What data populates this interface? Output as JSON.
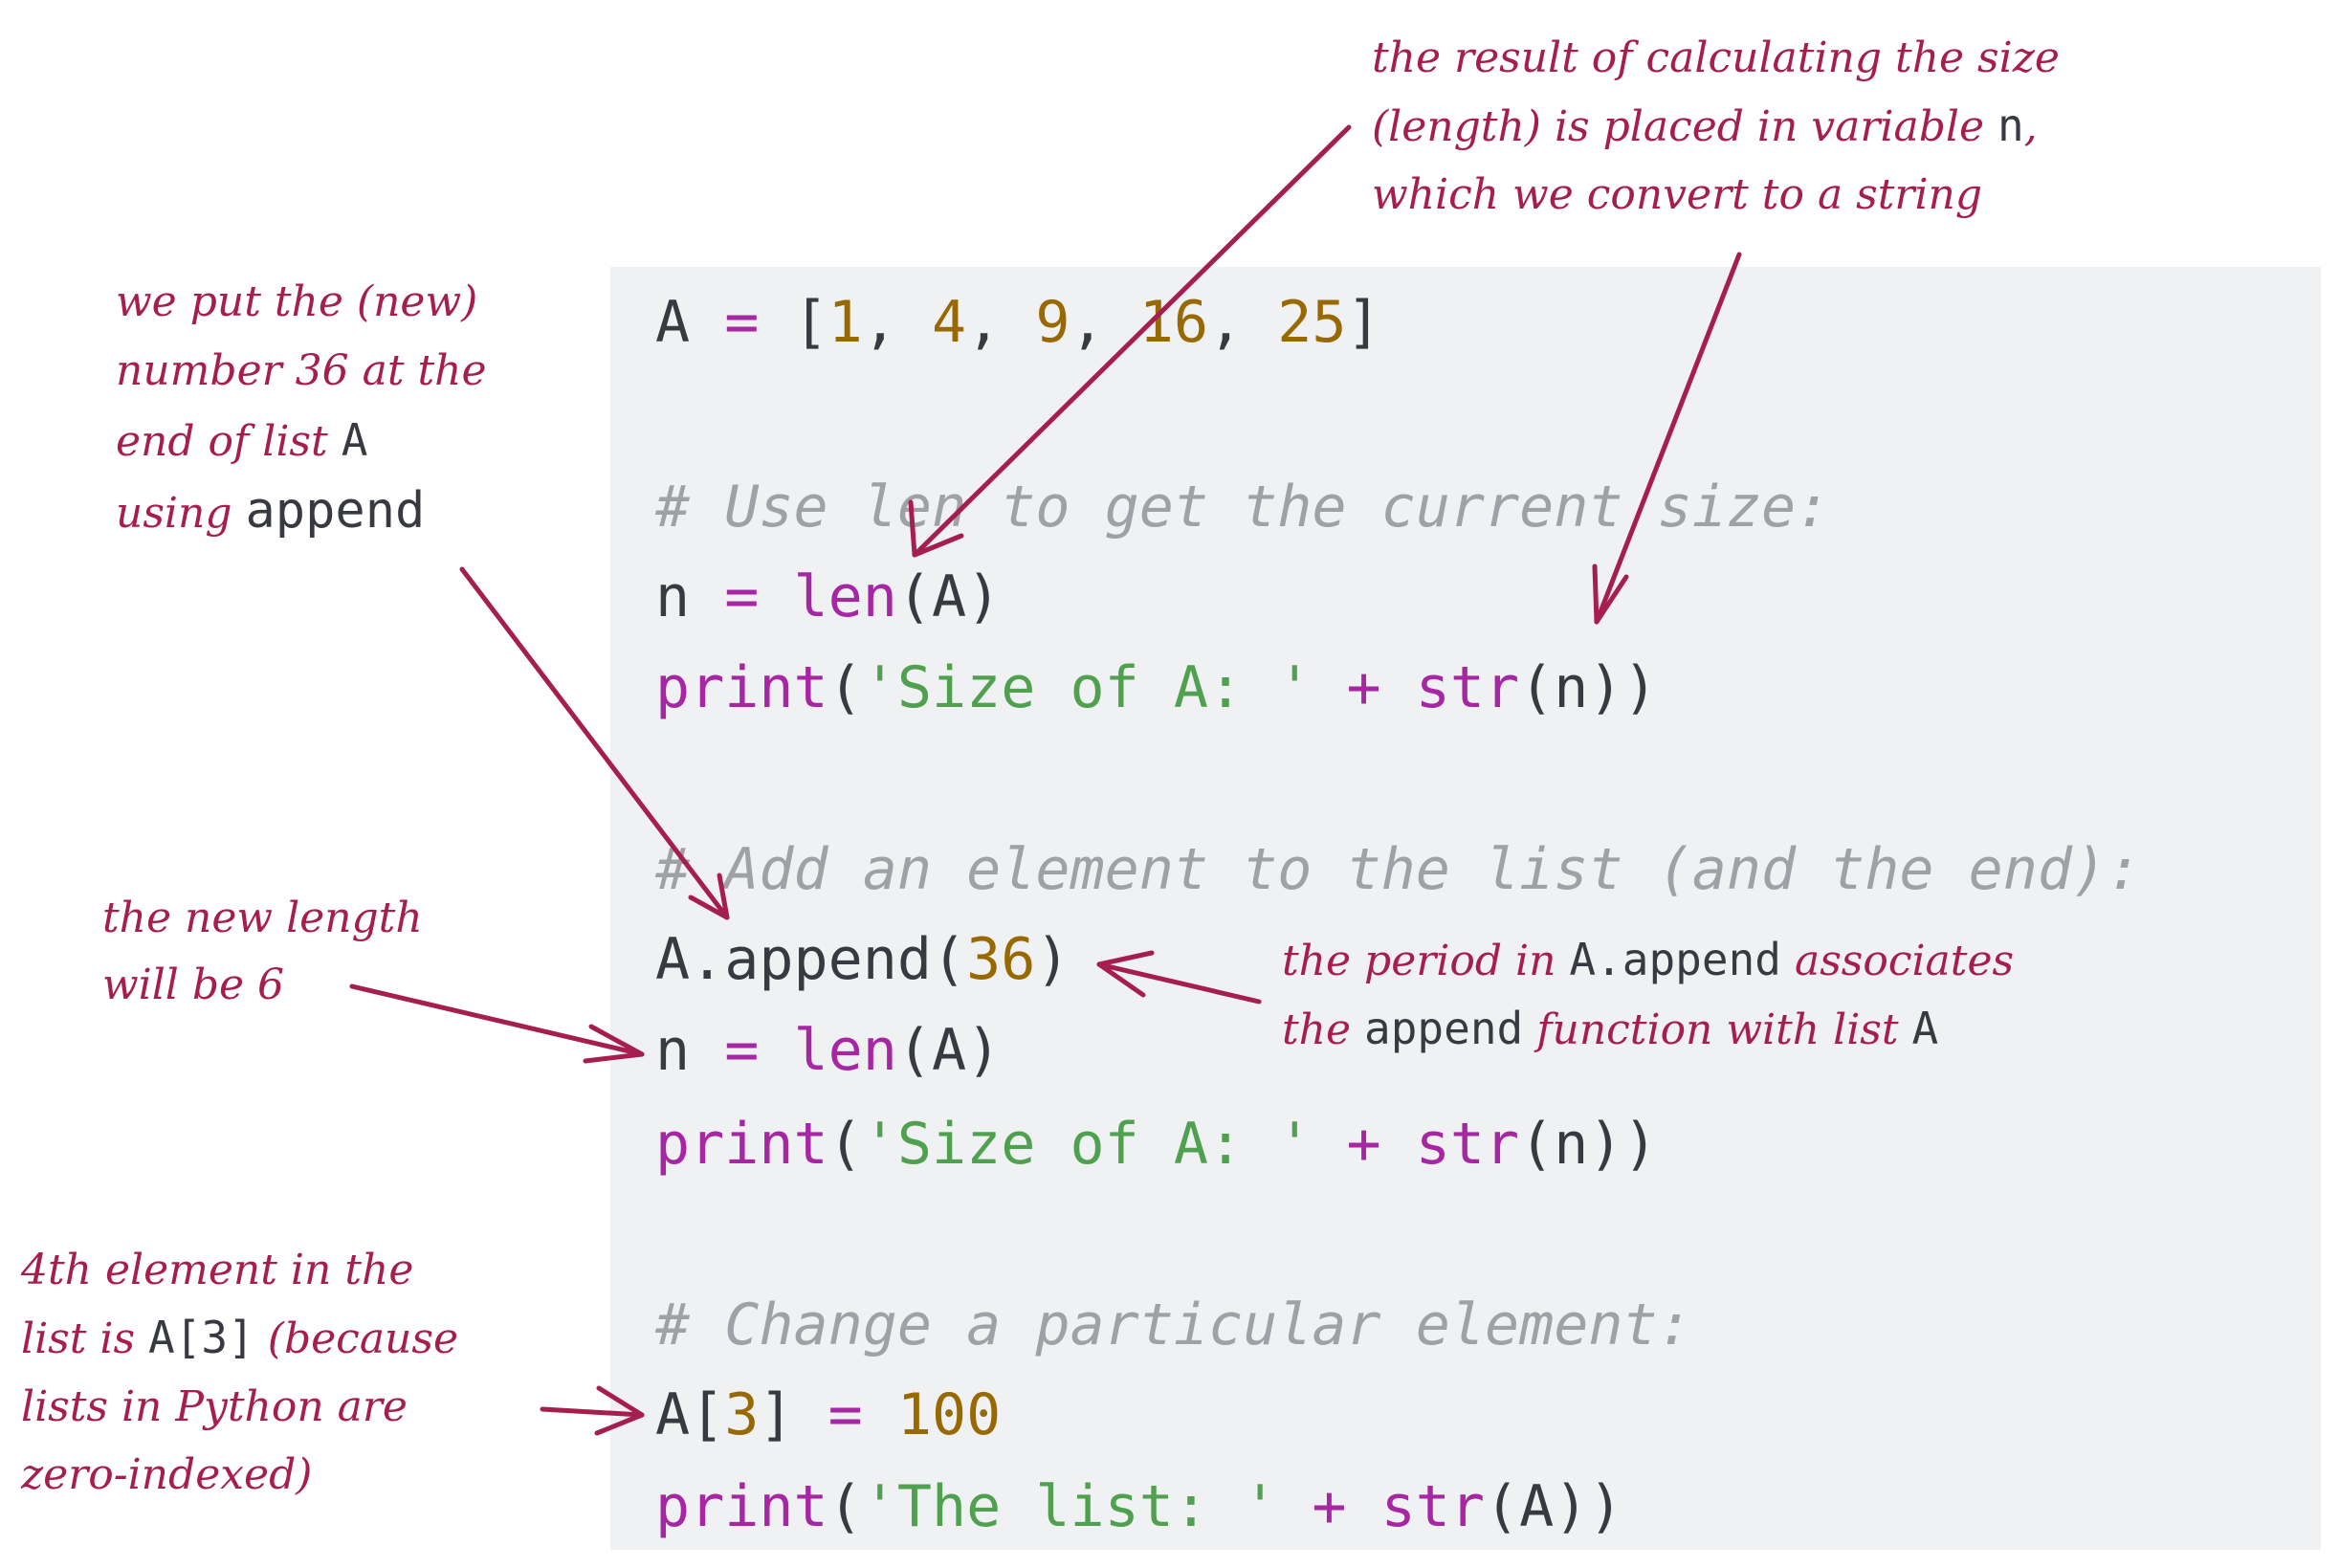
{
  "theme": {
    "annotation_color": "#a61e4d",
    "code_background": "#f0f1f3",
    "keyword_color": "#a626a4",
    "number_color": "#986801",
    "string_color": "#50a14f",
    "comment_color": "#a0a1a7",
    "text_color": "#383a42"
  },
  "code": {
    "line1": {
      "a": "A",
      "eq": " = ",
      "open": "[",
      "n1": "1",
      "c1": ", ",
      "n2": "4",
      "c2": ", ",
      "n3": "9",
      "c3": ", ",
      "n4": "16",
      "c4": ", ",
      "n5": "25",
      "close": "]"
    },
    "comment1": "# Use len to get the current size:",
    "line_len1": {
      "n": "n",
      "eq": " = ",
      "fn": "len",
      "args": "(A)"
    },
    "print1": {
      "fn": "print",
      "open": "(",
      "str": "'Size of A: '",
      "plus": " + ",
      "fn2": "str",
      "args": "(n))"
    },
    "comment2": "# Add an element to the list (and the end):",
    "append": {
      "obj": "A.append(",
      "num": "36",
      "close": ")"
    },
    "line_len2": {
      "n": "n",
      "eq": " = ",
      "fn": "len",
      "args": "(A)"
    },
    "print2": {
      "fn": "print",
      "open": "(",
      "str": "'Size of A: '",
      "plus": " + ",
      "fn2": "str",
      "args": "(n))"
    },
    "comment3": "# Change a particular element:",
    "assign": {
      "a": "A[",
      "idx": "3",
      "close": "]",
      "eq": " = ",
      "num": "100"
    },
    "print3": {
      "fn": "print",
      "open": "(",
      "str": "'The list: '",
      "plus": " + ",
      "fn2": "str",
      "args": "(A))"
    }
  },
  "annotations": {
    "top_right": {
      "line1": "the result of calculating the size",
      "line2_text": "(length) is placed in variable ",
      "line2_code": "n",
      "line2_tail": ",",
      "line3": "which we convert to a string"
    },
    "left_append": {
      "line1": "we put the (new)",
      "line2": "number 36 at the",
      "line3_text": "end of list ",
      "line3_code": "A",
      "line4_text": "using ",
      "line4_code": "append"
    },
    "new_length": {
      "line1": "the new length",
      "line2": "will be 6"
    },
    "period": {
      "line1_text": "the period in ",
      "line1_code": "A.append",
      "line1_tail": " associates",
      "line2_text": "the ",
      "line2_code": "append",
      "line2_mid": " function with list ",
      "line2_code2": "A"
    },
    "index": {
      "line1": "4th element in the",
      "line2_text": "list is ",
      "line2_code": "A[3]",
      "line2_tail": " (because",
      "line3": "lists in Python are",
      "line4": "zero-indexed)"
    }
  }
}
